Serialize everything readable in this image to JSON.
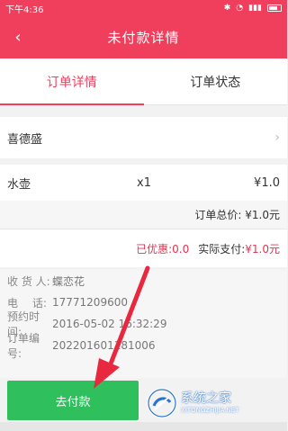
{
  "status_bar": {
    "time": "下午4:36",
    "icons": [
      "bluetooth-icon",
      "wifi-icon",
      "signal-icon",
      "battery-icon"
    ]
  },
  "header": {
    "back_icon": "chevron-left-icon",
    "title": "未付款详情"
  },
  "tabs": [
    {
      "label": "订单详情",
      "active": true
    },
    {
      "label": "订单状态",
      "active": false
    }
  ],
  "shop": {
    "name": "喜德盛"
  },
  "item": {
    "name": "水壶",
    "qty": "x1",
    "price": "¥1.0"
  },
  "total": {
    "text": "订单总价: ¥1.0元"
  },
  "payment": {
    "discount": "已优惠:0.0",
    "actual_label": "实际支付:",
    "actual_value": "¥1.0元"
  },
  "info": {
    "receiver_label": "收 货 人:",
    "receiver_value": "蝶恋花",
    "phone_label": "电　 话:",
    "phone_value": "17771209600",
    "time_label": "预约时间:",
    "time_value": "2016-05-02 16:32:29",
    "order_label": "订单编号:",
    "order_value": "202201601181006"
  },
  "button": {
    "label": "去付款"
  },
  "watermark": {
    "main": "系统之家",
    "sub": "XITONGZHIJIA.NET"
  },
  "colors": {
    "brand": "#ef3f5d",
    "accent_red": "#e8334f",
    "pay_green": "#2fbf5d"
  }
}
